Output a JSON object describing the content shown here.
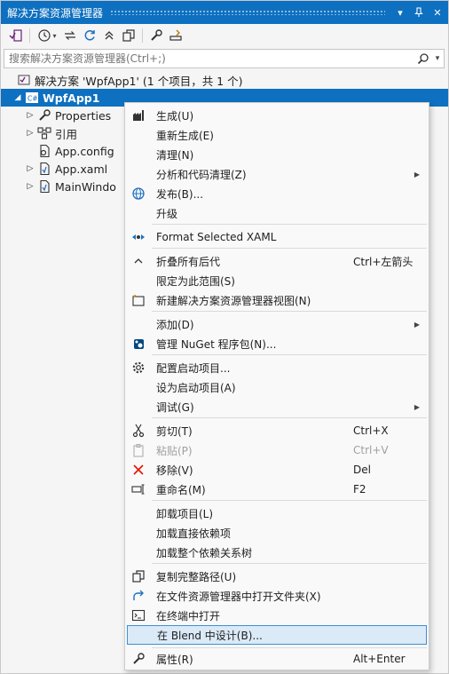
{
  "window": {
    "title": "解决方案资源管理器",
    "controls": {
      "pin": "▾",
      "dock": "⊥",
      "close": "✕"
    }
  },
  "toolbar": {
    "icons": [
      "vs-solution-icon",
      "history-icon",
      "sync-icon",
      "refresh-icon",
      "collapse-icon",
      "copy-icon",
      "properties-icon",
      "preview-icon"
    ]
  },
  "search": {
    "placeholder": "搜索解决方案资源管理器(Ctrl+;)"
  },
  "tree": {
    "solution": "解决方案 'WpfApp1' (1 个项目，共 1 个)",
    "project": "WpfApp1",
    "items": [
      {
        "label": "Properties"
      },
      {
        "label": "引用"
      },
      {
        "label": "App.config"
      },
      {
        "label": "App.xaml"
      },
      {
        "label": "MainWindo"
      }
    ]
  },
  "menu": {
    "build": "生成(U)",
    "rebuild": "重新生成(E)",
    "clean": "清理(N)",
    "analyze": "分析和代码清理(Z)",
    "publish": "发布(B)...",
    "upgrade": "升级",
    "format_xaml": "Format Selected XAML",
    "collapse_all": "折叠所有后代",
    "collapse_all_shortcut": "Ctrl+左箭头",
    "scope": "限定为此范围(S)",
    "new_view": "新建解决方案资源管理器视图(N)",
    "add": "添加(D)",
    "nuget": "管理 NuGet 程序包(N)...",
    "configure_startup": "配置启动项目...",
    "set_startup": "设为启动项目(A)",
    "debug": "调试(G)",
    "cut": "剪切(T)",
    "cut_shortcut": "Ctrl+X",
    "paste": "粘贴(P)",
    "paste_shortcut": "Ctrl+V",
    "remove": "移除(V)",
    "remove_shortcut": "Del",
    "rename": "重命名(M)",
    "rename_shortcut": "F2",
    "unload": "卸载项目(L)",
    "load_direct": "加载直接依赖项",
    "load_tree": "加载整个依赖关系树",
    "copy_path": "复制完整路径(U)",
    "open_folder": "在文件资源管理器中打开文件夹(X)",
    "open_terminal": "在终端中打开",
    "design_blend": "在 Blend 中设计(B)...",
    "properties": "属性(R)",
    "properties_shortcut": "Alt+Enter"
  },
  "colors": {
    "accent": "#0e70c0",
    "highlight_bg": "#dbeaf7",
    "highlight_border": "#3f8fd4"
  }
}
